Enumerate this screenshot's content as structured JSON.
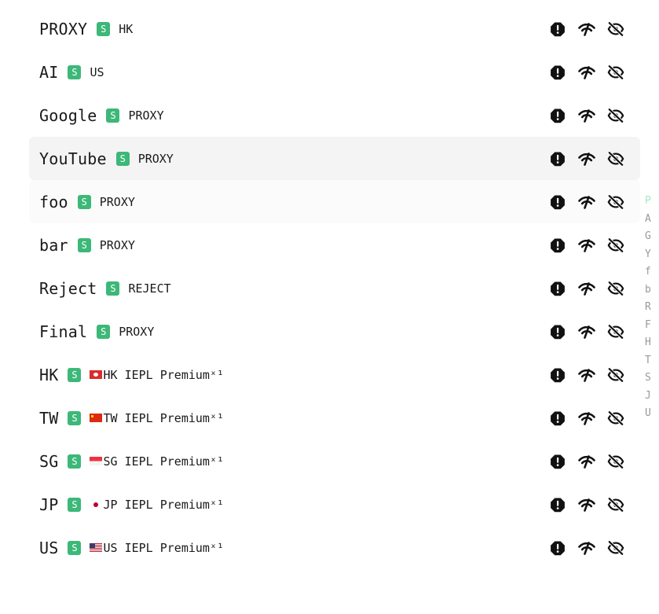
{
  "badge_label": "S",
  "colors": {
    "badge": "#3cb878",
    "row_highlight": "#f4f4f4",
    "index_active": "#a8e6c6"
  },
  "groups": [
    {
      "name": "PROXY",
      "current": "HK",
      "flag": ""
    },
    {
      "name": "AI",
      "current": "US",
      "flag": ""
    },
    {
      "name": "Google",
      "current": "PROXY",
      "flag": ""
    },
    {
      "name": "YouTube",
      "current": "PROXY",
      "flag": ""
    },
    {
      "name": "foo",
      "current": "PROXY",
      "flag": ""
    },
    {
      "name": "bar",
      "current": "PROXY",
      "flag": ""
    },
    {
      "name": "Reject",
      "current": "REJECT",
      "flag": ""
    },
    {
      "name": "Final",
      "current": "PROXY",
      "flag": ""
    },
    {
      "name": "HK",
      "current": "HK IEPL Premiumˣ¹",
      "flag": "hk"
    },
    {
      "name": "TW",
      "current": "TW IEPL Premiumˣ¹",
      "flag": "tw"
    },
    {
      "name": "SG",
      "current": "SG IEPL Premiumˣ¹",
      "flag": "sg"
    },
    {
      "name": "JP",
      "current": "JP IEPL Premiumˣ¹",
      "flag": "jp"
    },
    {
      "name": "US",
      "current": "US IEPL Premiumˣ¹",
      "flag": "us"
    }
  ],
  "row_actions": [
    "alert-octagon-icon",
    "speedtest-wifi-icon",
    "eye-off-icon"
  ],
  "index_letters": [
    "P",
    "A",
    "G",
    "Y",
    "f",
    "b",
    "R",
    "F",
    "H",
    "T",
    "S",
    "J",
    "U"
  ]
}
